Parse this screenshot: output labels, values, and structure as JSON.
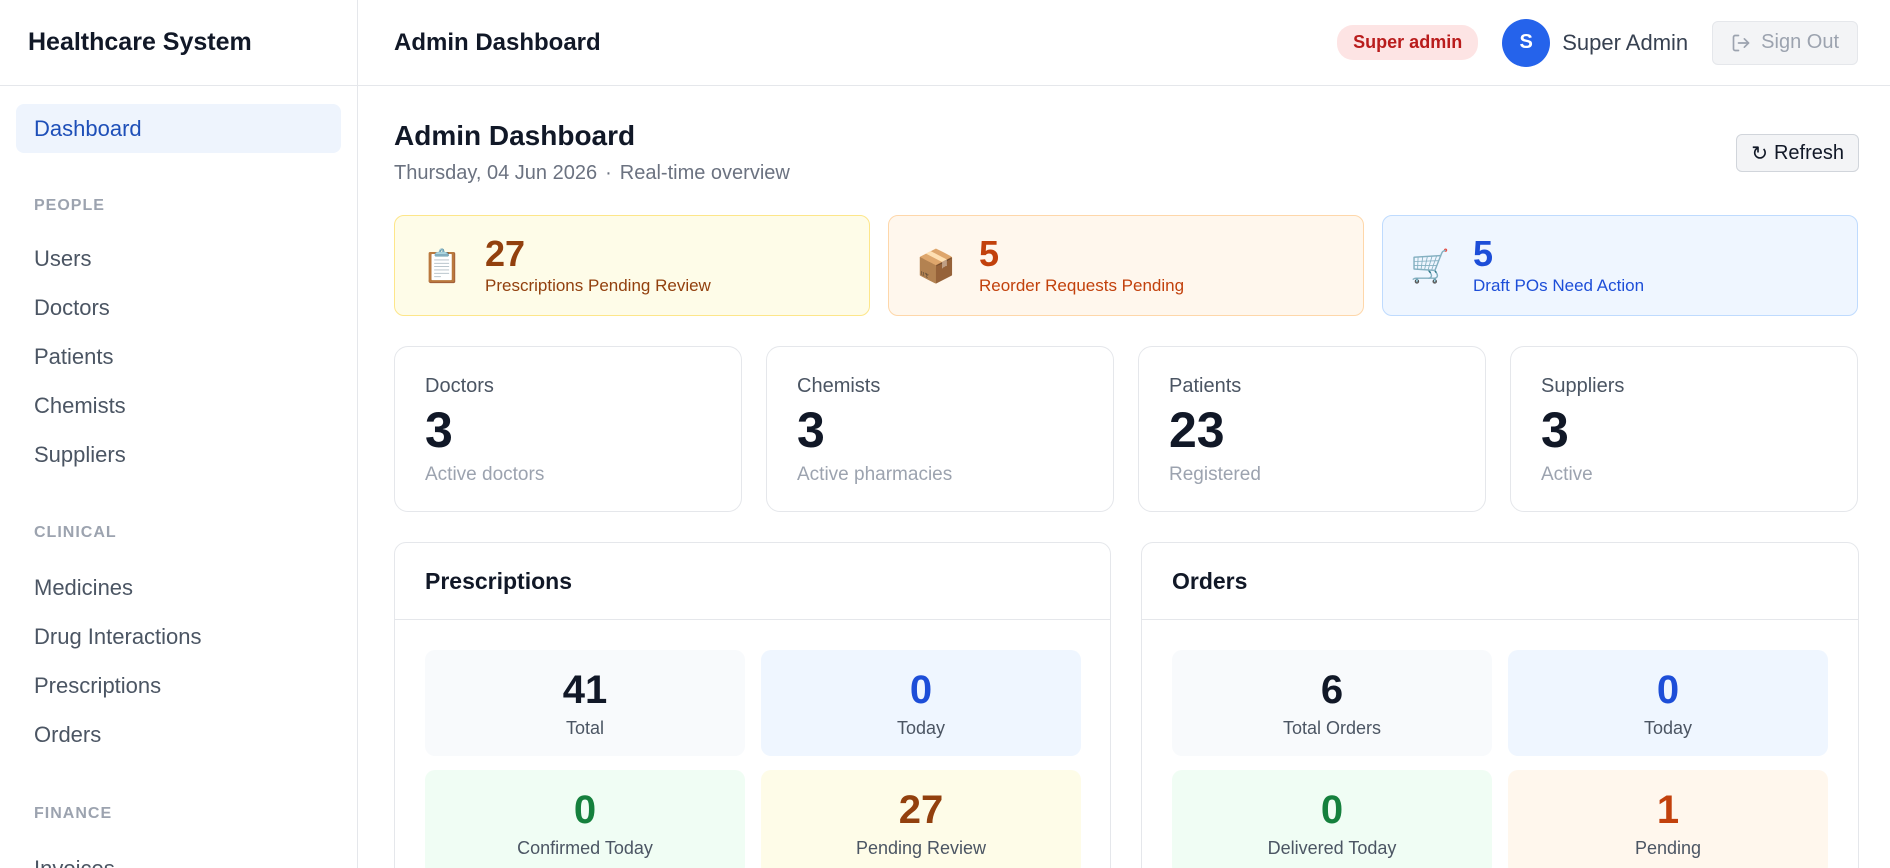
{
  "app": {
    "title": "Healthcare System"
  },
  "sidebar": {
    "items": [
      {
        "label": "Dashboard",
        "active": true
      }
    ],
    "sections": [
      {
        "heading": "PEOPLE",
        "items": [
          "Users",
          "Doctors",
          "Patients",
          "Chemists",
          "Suppliers"
        ]
      },
      {
        "heading": "CLINICAL",
        "items": [
          "Medicines",
          "Drug Interactions",
          "Prescriptions",
          "Orders"
        ]
      },
      {
        "heading": "FINANCE",
        "items": [
          "Invoices"
        ]
      }
    ]
  },
  "header": {
    "title": "Admin Dashboard",
    "role_badge": "Super admin",
    "avatar_initial": "S",
    "user_name": "Super Admin",
    "signout_label": "Sign Out",
    "signout_icon": "sign-out-icon"
  },
  "page": {
    "title": "Admin Dashboard",
    "date": "Thursday, 04 Jun 2026",
    "separator": "·",
    "subtitle": "Real-time overview",
    "refresh_label": "Refresh",
    "refresh_icon": "↻"
  },
  "alerts": [
    {
      "icon": "📋",
      "icon_name": "clipboard-icon",
      "value": "27",
      "label": "Prescriptions Pending Review",
      "color": "#92400e"
    },
    {
      "icon": "📦",
      "icon_name": "package-icon",
      "value": "5",
      "label": "Reorder Requests Pending",
      "color": "#c2410c"
    },
    {
      "icon": "🛒",
      "icon_name": "cart-icon",
      "value": "5",
      "label": "Draft POs Need Action",
      "color": "#1d4ed8"
    }
  ],
  "stats": [
    {
      "title": "Doctors",
      "value": "3",
      "sub": "Active doctors"
    },
    {
      "title": "Chemists",
      "value": "3",
      "sub": "Active pharmacies"
    },
    {
      "title": "Patients",
      "value": "23",
      "sub": "Registered"
    },
    {
      "title": "Suppliers",
      "value": "3",
      "sub": "Active"
    }
  ],
  "panels": {
    "prescriptions": {
      "title": "Prescriptions",
      "tiles": [
        {
          "value": "41",
          "label": "Total"
        },
        {
          "value": "0",
          "label": "Today"
        },
        {
          "value": "0",
          "label": "Confirmed Today"
        },
        {
          "value": "27",
          "label": "Pending Review"
        }
      ]
    },
    "orders": {
      "title": "Orders",
      "tiles": [
        {
          "value": "6",
          "label": "Total Orders"
        },
        {
          "value": "0",
          "label": "Today"
        },
        {
          "value": "0",
          "label": "Delivered Today"
        },
        {
          "value": "1",
          "label": "Pending"
        }
      ]
    }
  }
}
